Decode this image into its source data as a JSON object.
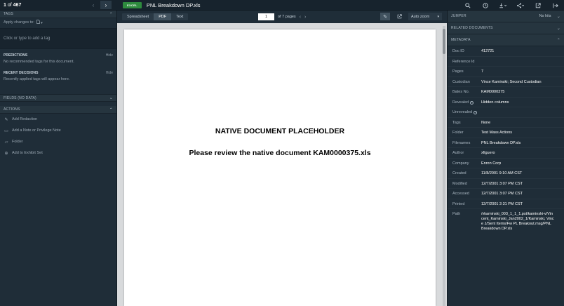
{
  "nav": {
    "current": "1",
    "of": "of",
    "total": "467"
  },
  "document": {
    "badge": "EXCEL",
    "name": "PNL Breakdown DP.xls"
  },
  "topbar_icons": [
    "search-icon",
    "history-icon",
    "download-icon",
    "share-icon",
    "external-link-icon",
    "exit-icon"
  ],
  "left": {
    "tags_header": "TAGS",
    "apply_label": "Apply changes to:",
    "tag_placeholder": "Click or type to add a tag",
    "predictions": {
      "title": "PREDICTIONS",
      "hide": "Hide",
      "text": "No recommended tags for this document."
    },
    "recent": {
      "title": "RECENT DECISIONS",
      "hide": "Hide",
      "text": "Recently applied tags will appear here."
    },
    "fields_header": "FIELDS (No Data)",
    "actions_header": "ACTIONS",
    "actions": [
      {
        "label": "Add Redaction",
        "icon": "redaction-icon"
      },
      {
        "label": "Add a Note or Privilege Note",
        "icon": "note-icon"
      },
      {
        "label": "Folder",
        "icon": "folder-icon"
      },
      {
        "label": "Add to Exhibit Set",
        "icon": "exhibit-icon"
      }
    ]
  },
  "viewer": {
    "tabs": [
      "Spreadsheet",
      "PDF",
      "Text"
    ],
    "active_tab": "PDF",
    "page_input": "1",
    "page_of": "of 7 pages",
    "zoom": "Auto zoom",
    "placeholder_title": "NATIVE DOCUMENT PLACEHOLDER",
    "placeholder_sub": "Please review the native document KAM0000375.xls"
  },
  "right": {
    "jumper": {
      "label": "JUMPER",
      "value": "No hits"
    },
    "related": "RELATED DOCUMENTS",
    "metadata_header": "METADATA",
    "metadata": [
      {
        "label": "Doc ID",
        "value": "412721"
      },
      {
        "label": "Reference Id",
        "value": ""
      },
      {
        "label": "Pages",
        "value": "7"
      },
      {
        "label": "Custodian",
        "value": "Vince Kaminski; Second Custodian"
      },
      {
        "label": "Bates No.",
        "value": "KAM0000375"
      },
      {
        "label": "Revealed",
        "value": "Hidden columns"
      },
      {
        "label": "Unrevealed",
        "value": ""
      },
      {
        "label": "Tags",
        "value": "None"
      },
      {
        "label": "Folder",
        "value": "Test Mass Actions"
      },
      {
        "label": "Filenames",
        "value": "PNL Breakdown DP.xls"
      },
      {
        "label": "Author",
        "value": "xfiguero"
      },
      {
        "label": "Company",
        "value": "Enron Corp"
      },
      {
        "label": "Created",
        "value": "11/8/2001 9:10 AM CST"
      },
      {
        "label": "Modified",
        "value": "12/7/2001 3:07 PM CST"
      },
      {
        "label": "Accessed",
        "value": "12/7/2001 3:07 PM CST"
      },
      {
        "label": "Printed",
        "value": "12/7/2001 2:31 PM CST"
      },
      {
        "label": "Path",
        "value": "/vkaminski_003_1_1_1.pst/kaminski-v/Vincent_Kaminski_Jan2002_1/Kaminski, Vince J/Sent Items/Fw PL Breakout.msg/PNL Breakdown DP.xls"
      }
    ]
  }
}
